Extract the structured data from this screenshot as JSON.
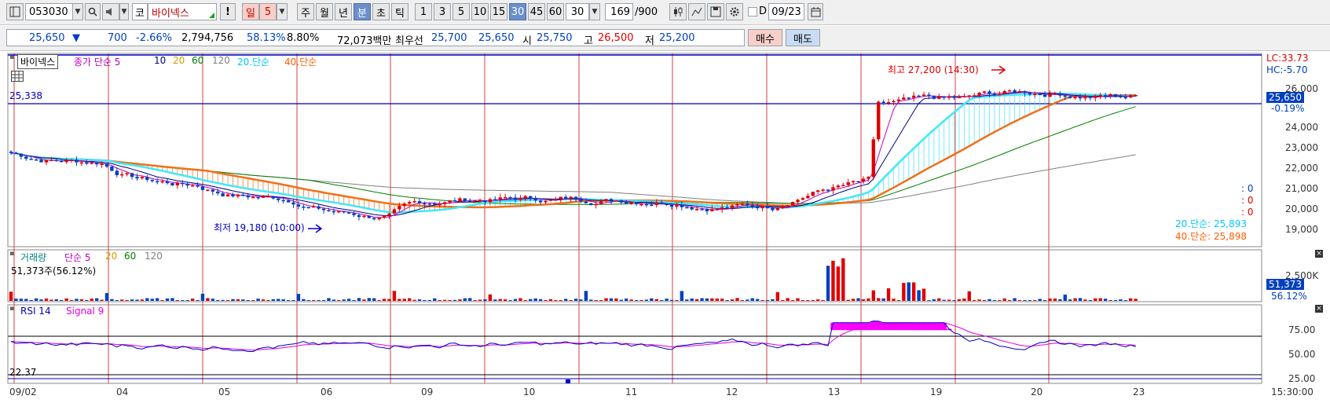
{
  "toolbar": {
    "code": "053030",
    "market_badge": "코",
    "stock_name": "바이넥스",
    "alert": "!",
    "period_day": "일",
    "period_value": "5",
    "period_week": "주",
    "period_month": "월",
    "period_year": "년",
    "period_minute": "분",
    "period_second": "초",
    "period_tick": "틱",
    "interval_buttons": [
      "1",
      "3",
      "5",
      "10",
      "15",
      "30",
      "45",
      "60"
    ],
    "interval_selected": "30",
    "interval_dropdown": "30",
    "count_value": "169",
    "count_total": "/900",
    "date_prefix": "D",
    "date_value": "09/23"
  },
  "quote": {
    "price": "25,650",
    "arrow": "▼",
    "change": "700",
    "change_pct": "-2.66%",
    "volume": "2,794,756",
    "vol_ratio": "58.13%",
    "turnover": "8.80%",
    "amount": "72,073백만",
    "best_label": "최우선",
    "best_ask": "25,700",
    "best_bid": "25,650",
    "open_label": "시",
    "open": "25,750",
    "high_label": "고",
    "high": "26,500",
    "low_label": "저",
    "low": "25,200",
    "buy_label": "매수",
    "sell_label": "매도"
  },
  "price_panel": {
    "name_badge": "바이넥스",
    "legend": [
      "종가 단순 5",
      "10",
      "20",
      "60",
      "120",
      "20.단순",
      "40.단순"
    ],
    "legend_colors": [
      "#c000c0",
      "#000080",
      "#d4a000",
      "#008000",
      "#808080",
      "#00c8ff",
      "#ff6000"
    ],
    "hline_value": "25,338",
    "high_annot": "최고 27,200 (14:30)",
    "low_annot": "최저 19,180 (10:00)",
    "lc": "LC:33.73",
    "hc": "HC:-5.70",
    "current": "25,650",
    "current_pct": "-0.19%",
    "ma20_label": "20.단순: 25,893",
    "ma40_label": "40.단순: 25,898",
    "zero_labels": [
      ": 0",
      ": 0",
      ": 0"
    ],
    "y_ticks": [
      "26,000",
      "25,000",
      "24,000",
      "23,000",
      "22,000",
      "21,000",
      "20,000",
      "19,000"
    ]
  },
  "volume_panel": {
    "legend": [
      "거래량",
      "단순 5",
      "20",
      "60",
      "120"
    ],
    "legend_colors": [
      "#008080",
      "#c000c0",
      "#d4a000",
      "#008000",
      "#808080"
    ],
    "value_text": "51,373주(56.12%)",
    "current": "51,373",
    "current_pct": "56.12%",
    "y_ticks": [
      "2,500K"
    ]
  },
  "rsi_panel": {
    "legend": [
      "RSI 14",
      "Signal 9"
    ],
    "legend_colors": [
      "#0000c0",
      "#e000e0"
    ],
    "value_text": "22.37",
    "y_ticks": [
      "75.00",
      "50.00",
      "25.00"
    ]
  },
  "x_axis": {
    "labels": [
      "09/02",
      "04",
      "05",
      "06",
      "09",
      "10",
      "11",
      "12",
      "13",
      "19",
      "20",
      "23"
    ],
    "time": "15:30:00"
  },
  "colors": {
    "up": "#e00000",
    "down": "#0040c0",
    "ma20": "#40e8f8",
    "ma40": "#f07018",
    "grid_v": "#d04040",
    "hline": "#0000c0"
  },
  "chart_data": {
    "type": "candlestick",
    "title": "바이넥스",
    "y_range": [
      18500,
      27500
    ],
    "day_labels": [
      "09/02",
      "04",
      "05",
      "06",
      "09",
      "10",
      "11",
      "12",
      "13",
      "19",
      "20",
      "23"
    ],
    "highest": {
      "value": 27200,
      "time": "14:30"
    },
    "lowest": {
      "value": 19180,
      "time": "10:00"
    },
    "approx_close_by_day": [
      22500,
      21300,
      20700,
      19800,
      20800,
      20700,
      20800,
      20400,
      21600,
      25400,
      25900,
      25650
    ],
    "current_price": 25650
  }
}
